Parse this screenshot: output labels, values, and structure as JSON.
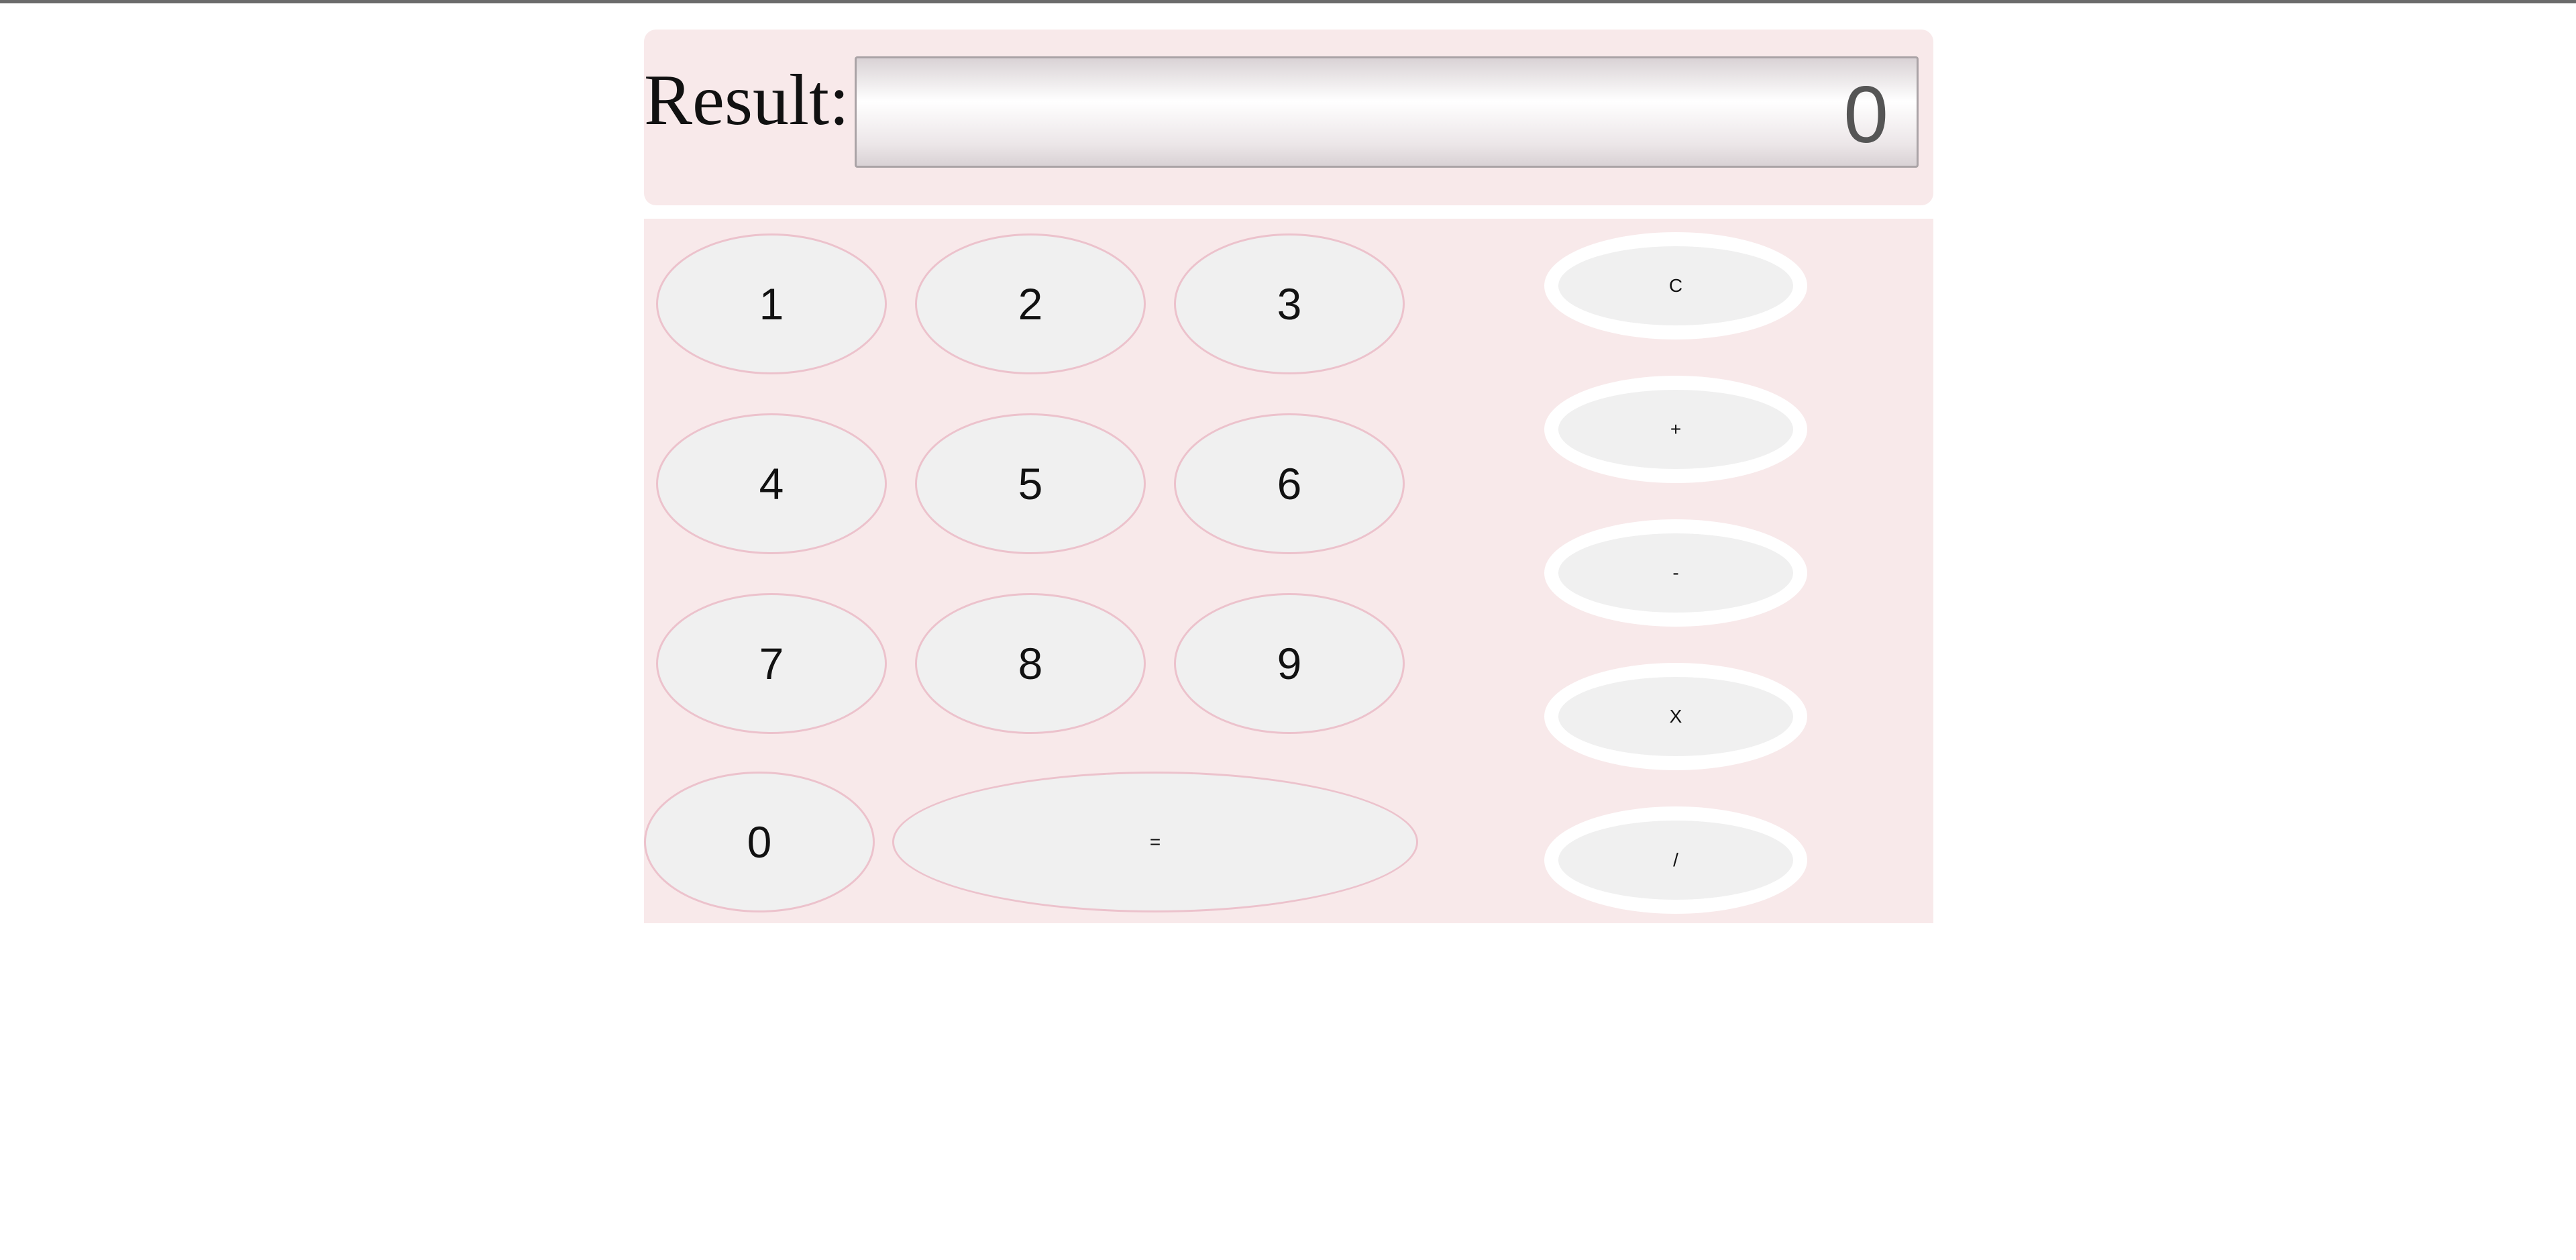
{
  "result": {
    "label": "Result:",
    "value": "0"
  },
  "keypad": {
    "digits": [
      "1",
      "2",
      "3",
      "4",
      "5",
      "6",
      "7",
      "8",
      "9",
      "0"
    ],
    "equals": "="
  },
  "operators": {
    "clear": "C",
    "add": "+",
    "subtract": "-",
    "multiply": "X",
    "divide": "/"
  },
  "colors": {
    "panel_background": "#f8e9ea",
    "key_fill": "#f0f0f0",
    "key_border": "#ecc2cc",
    "operator_ring": "#ffffff"
  }
}
